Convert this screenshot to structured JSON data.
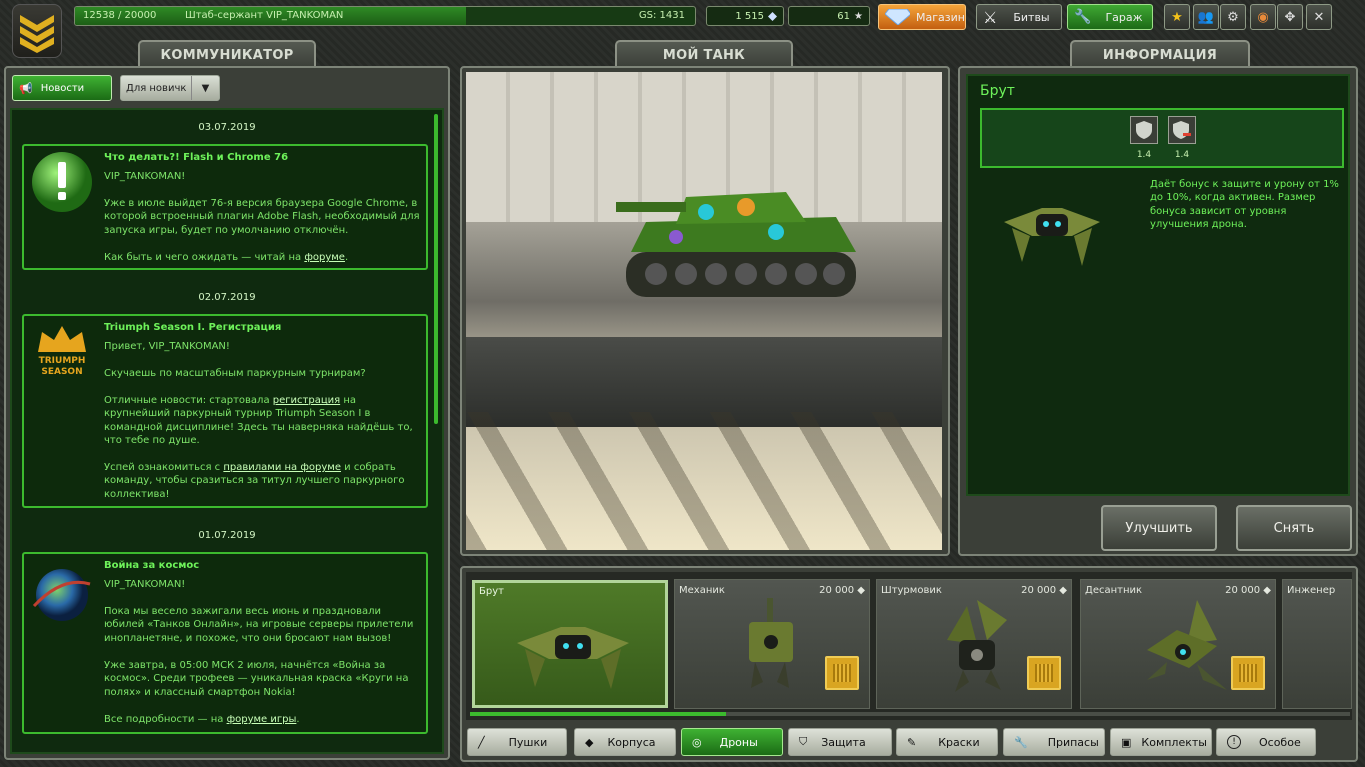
{
  "top": {
    "xp": "12538 / 20000",
    "rank": "Штаб-сержант VIP_TANKOMAN",
    "gs": "GS: 1431",
    "crystals": "1 515",
    "stars": "61",
    "shop": "Магазин",
    "battles": "Битвы",
    "garage": "Гараж"
  },
  "tabs": {
    "comm": "КОММУНИКАТОР",
    "tank": "МОЙ ТАНК",
    "info": "ИНФОРМАЦИЯ"
  },
  "news": {
    "btn_news": "Новости",
    "select_value": "Для новичк",
    "items": [
      {
        "date": "03.07.2019",
        "title": "Что делать?! Flash и Chrome 76",
        "p1": "VIP_TANKOMAN!",
        "p2": "Уже в июле выйдет 76-я версия браузера Google Chrome, в которой встроенный плагин Adobe Flash, необходимый для запуска игры, будет по умолчанию отключён.",
        "p3": "Как быть и чего ожидать — читай на ",
        "p3_link": "форуме",
        "p3_end": "."
      },
      {
        "date": "02.07.2019",
        "title": "Triumph Season I. Регистрация",
        "p1": "Привет, VIP_TANKOMAN!",
        "p2": "Скучаешь по масштабным паркурным турнирам?",
        "p3a": "Отличные новости: стартовала ",
        "p3_link": "регистрация",
        "p3b": " на крупнейший паркурный турнир Triumph Season I в командной дисциплине! Здесь ты наверняка найдёшь то, что тебе по душе.",
        "p4a": "Успей ознакомиться с ",
        "p4_link": "правилами на форуме",
        "p4b": " и собрать команду, чтобы сразиться за титул лучшего паркурного коллектива!",
        "logo1": "TRIUMPH",
        "logo2": "SEASON"
      },
      {
        "date": "01.07.2019",
        "title": "Война за космос",
        "p1": "VIP_TANKOMAN!",
        "p2": "Пока мы весело зажигали весь июнь и праздновали юбилей «Танков Онлайн», на игровые серверы прилетели инопланетяне, и похоже, что они бросают нам вызов!",
        "p3": "Уже завтра, в 05:00 МСК 2 июля, начнётся «Война за космос». Среди трофеев — уникальная краска «Круги на полях» и классный смартфон Nokia!",
        "p4": "Все подробности — на ",
        "p4_link": "форуме игры",
        "p4_end": "."
      }
    ]
  },
  "info": {
    "title": "Брут",
    "stat1": "1.4",
    "stat2": "1.4",
    "desc": "Даёт бонус к защите и урону от 1% до 10%, когда активен. Размер бонуса зависит от уровня улучшения дрона.",
    "upgrade": "Улучшить",
    "remove": "Снять"
  },
  "drones": [
    {
      "name": "Брут",
      "price": ""
    },
    {
      "name": "Механик",
      "price": "20 000"
    },
    {
      "name": "Штурмовик",
      "price": "20 000"
    },
    {
      "name": "Десантник",
      "price": "20 000"
    },
    {
      "name": "Инженер",
      "price": ""
    }
  ],
  "categories": [
    "Пушки",
    "Корпуса",
    "Дроны",
    "Защита",
    "Краски",
    "Припасы",
    "Комплекты",
    "Особое"
  ],
  "colors": {
    "accent": "#3cba2e",
    "panel_green": "#0f2a0f",
    "text_green": "#7ee56a"
  }
}
